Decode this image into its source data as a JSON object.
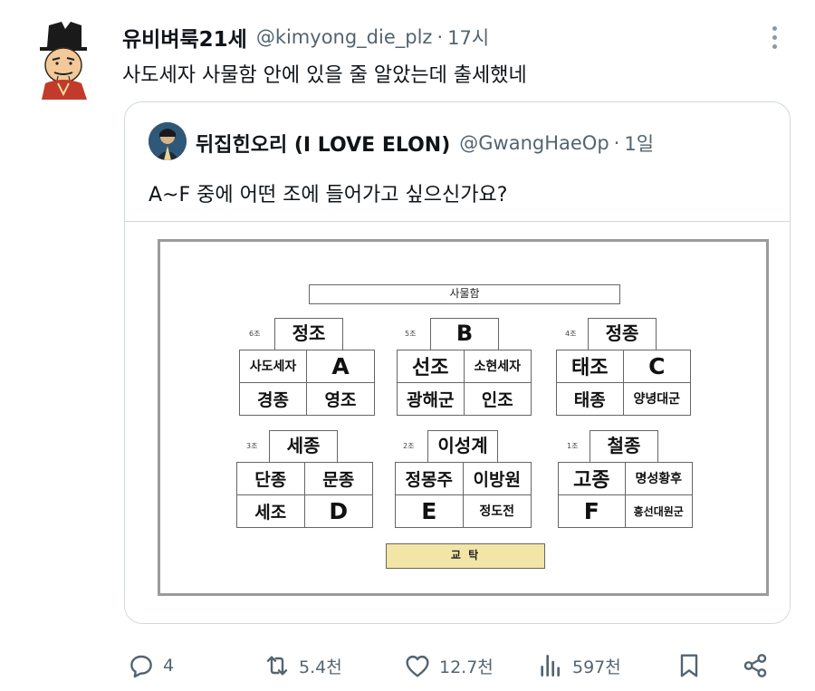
{
  "tweet": {
    "author_name": "유비벼룩21세",
    "handle": "@kimyong_die_plz",
    "separator": "·",
    "time": "17시",
    "text": "사도세자 사물함 안에 있을 줄 알았는데 출세했네",
    "avatar_icon": "joseon-official-avatar-icon",
    "more_icon": "more-options-icon"
  },
  "quote": {
    "author_name": "뒤집힌오리 (I LOVE ELON)",
    "handle": "@GwangHaeOp",
    "separator": "·",
    "time": "1일",
    "text": "A~F 중에 어떤 조에 들어가고 싶으신가요?",
    "avatar_icon": "profile-avatar-icon",
    "image": {
      "title": "사물함",
      "desk_label": "교 탁",
      "groups": [
        {
          "id": "g6",
          "number": "6조",
          "label": "정조",
          "cells": [
            "사도세자",
            "A",
            "경종",
            "영조"
          ]
        },
        {
          "id": "g5",
          "number": "5조",
          "label": "B",
          "cells": [
            "선조",
            "소현세자",
            "광해군",
            "인조"
          ]
        },
        {
          "id": "g4",
          "number": "4조",
          "label": "정종",
          "cells": [
            "태조",
            "C",
            "태종",
            "양녕대군"
          ]
        },
        {
          "id": "g3",
          "number": "3조",
          "label": "세종",
          "cells": [
            "단종",
            "문종",
            "세조",
            "D"
          ]
        },
        {
          "id": "g2",
          "number": "2조",
          "label": "이성계",
          "cells": [
            "정몽주",
            "이방원",
            "E",
            "정도전"
          ]
        },
        {
          "id": "g1",
          "number": "1조",
          "label": "철종",
          "cells": [
            "고종",
            "명성황후",
            "F",
            "흥선대원군"
          ]
        }
      ]
    }
  },
  "actions": {
    "reply": {
      "icon": "reply-icon",
      "count": "4"
    },
    "retweet": {
      "icon": "retweet-icon",
      "count": "5.4천"
    },
    "like": {
      "icon": "heart-icon",
      "count": "12.7천"
    },
    "views": {
      "icon": "views-icon",
      "count": "597천"
    },
    "bookmark": {
      "icon": "bookmark-icon"
    },
    "share": {
      "icon": "share-icon"
    }
  },
  "colors": {
    "text": "#0f1419",
    "muted": "#536471",
    "border": "#cfd9de",
    "desk": "#f2e5a6"
  }
}
